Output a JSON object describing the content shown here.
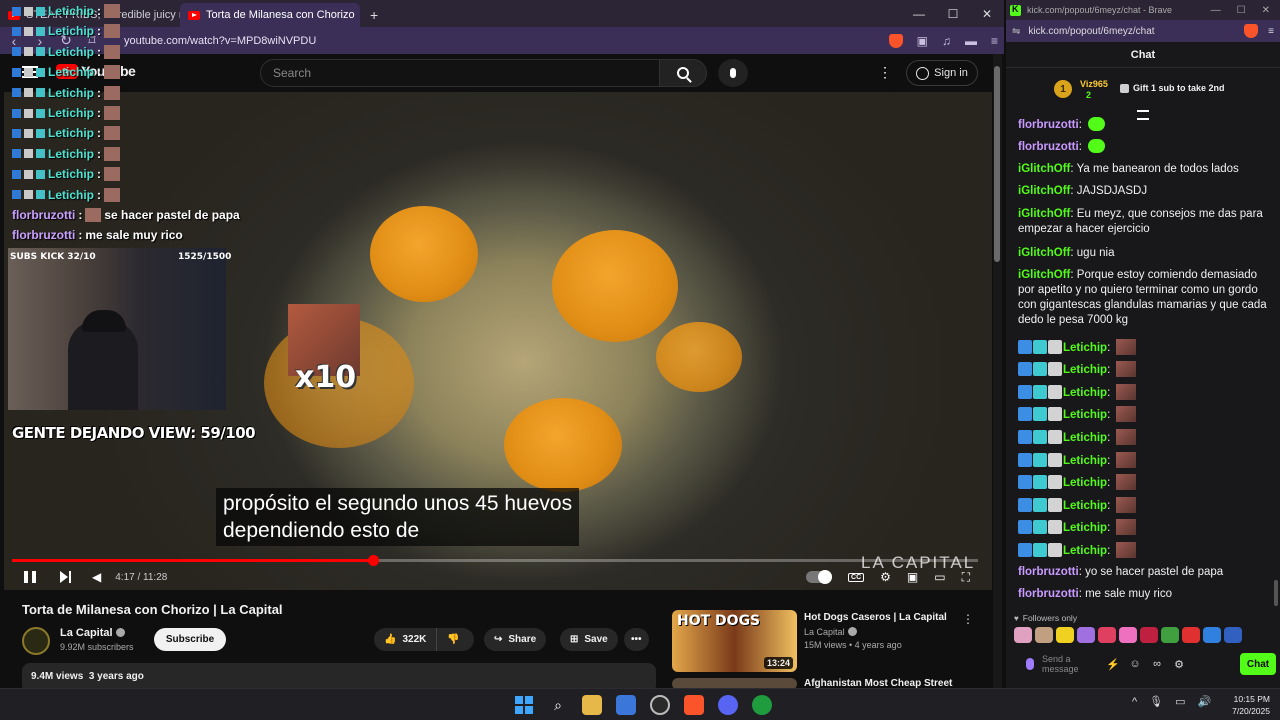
{
  "browser_left": {
    "tabs": [
      {
        "title": "STEAK FRIES, incredible juicy recipe",
        "active": false
      },
      {
        "title": "Torta de Milanesa con Chorizo",
        "active": true
      }
    ],
    "new_tab_glyph": "+",
    "window_controls": [
      "—",
      "☐",
      "✕"
    ],
    "url": "youtube.com/watch?v=MPD8wiNVPDU"
  },
  "youtube": {
    "logo_text": "YouTube",
    "search_placeholder": "Search",
    "sign_in_label": "Sign in",
    "video": {
      "caption_line1": "propósito el segundo unos 45 huevos",
      "caption_line2": "dependiendo esto de",
      "watermark": "LA CAPITAL",
      "time_display": "4:17 / 11:28",
      "progress_fraction": 0.374
    },
    "stream_overlay": {
      "subs_kick": "SUBS KICK 32/10",
      "subs_count": "1525/1500",
      "gente_view": "GENTE DEJANDO VIEW: 59/100",
      "multiplier": "x10"
    },
    "overlay_chat": [
      {
        "user": "Letichip",
        "text": ""
      },
      {
        "user": "Letichip",
        "text": ""
      },
      {
        "user": "Letichip",
        "text": ""
      },
      {
        "user": "Letichip",
        "text": ""
      },
      {
        "user": "Letichip",
        "text": ""
      },
      {
        "user": "Letichip",
        "text": ""
      },
      {
        "user": "Letichip",
        "text": ""
      },
      {
        "user": "Letichip",
        "text": ""
      },
      {
        "user": "Letichip",
        "text": ""
      },
      {
        "user": "Letichip",
        "text": ""
      },
      {
        "user": "florbruzotti",
        "text": "se hacer pastel de papa"
      },
      {
        "user": "florbruzotti",
        "text": "me sale muy rico"
      }
    ],
    "title": "Torta de Milanesa con Chorizo | La Capital",
    "channel": {
      "name": "La Capital",
      "subscribers": "9.92M subscribers"
    },
    "subscribe_label": "Subscribe",
    "likes": "322K",
    "share_label": "Share",
    "save_label": "Save",
    "more_glyph": "•••",
    "views": "9.4M views",
    "age": "3 years ago",
    "recommendations": [
      {
        "title": "Hot Dogs Caseros | La Capital",
        "channel": "La Capital",
        "meta": "15M views • 4 years ago",
        "duration": "13:24",
        "thumb_text": "HOT DOGS"
      },
      {
        "title": "Afghanistan Most Cheap Street",
        "channel": "",
        "meta": "",
        "duration": "",
        "thumb_text": ""
      }
    ]
  },
  "kick": {
    "window_title": "kick.com/popout/6meyz/chat - Brave",
    "url": "kick.com/popout/6meyz/chat",
    "chat_title": "Chat",
    "gifter": {
      "rank": "1",
      "user": "Viz965",
      "count": "2",
      "cta": "Gift 1 sub to take 2nd"
    },
    "messages": [
      {
        "user": "florbruzotti",
        "text": "",
        "style": "purple",
        "emote": "smile"
      },
      {
        "user": "florbruzotti",
        "text": "",
        "style": "purple",
        "emote": "smile"
      },
      {
        "user": "iGlitchOff",
        "text": "Ya me banearon de todos lados",
        "style": "green"
      },
      {
        "user": "iGlitchOff",
        "text": "JAJSDJASDJ",
        "style": "green"
      },
      {
        "user": "iGlitchOff",
        "text": "Eu meyz, que consejos me das para empezar a hacer ejercicio",
        "style": "green"
      },
      {
        "user": "iGlitchOff",
        "text": "ugu nia",
        "style": "green"
      },
      {
        "user": "iGlitchOff",
        "text": "Porque estoy comiendo demasiado por apetito y no quiero terminar como un gordo con gigantescas glandulas mamarias y que cada dedo le pesa 7000 kg",
        "style": "green"
      },
      {
        "user": "Letichip",
        "text": "",
        "style": "badged"
      },
      {
        "user": "Letichip",
        "text": "",
        "style": "badged"
      },
      {
        "user": "Letichip",
        "text": "",
        "style": "badged"
      },
      {
        "user": "Letichip",
        "text": "",
        "style": "badged"
      },
      {
        "user": "Letichip",
        "text": "",
        "style": "badged"
      },
      {
        "user": "Letichip",
        "text": "",
        "style": "badged"
      },
      {
        "user": "Letichip",
        "text": "",
        "style": "badged"
      },
      {
        "user": "Letichip",
        "text": "",
        "style": "badged"
      },
      {
        "user": "Letichip",
        "text": "",
        "style": "badged"
      },
      {
        "user": "Letichip",
        "text": "",
        "style": "badged"
      },
      {
        "user": "florbruzotti",
        "text": "yo se hacer pastel de papa",
        "style": "purple"
      },
      {
        "user": "florbruzotti",
        "text": "me sale muy rico",
        "style": "purple"
      }
    ],
    "followers_only": "Followers only",
    "input_placeholder": "Send a message",
    "chat_button": "Chat",
    "emote_colors": [
      "#e0a0c0",
      "#c0a080",
      "#f0d020",
      "#a070e0",
      "#e04060",
      "#f070c0",
      "#c02040",
      "#40a040",
      "#e03030",
      "#3080e0",
      "#3060c0"
    ]
  },
  "taskbar": {
    "time": "10:15 PM",
    "date": "7/20/2025",
    "tray_glyphs": [
      "^",
      "🎙",
      "▭",
      "🔊"
    ]
  },
  "colors": {
    "youtube_red": "#ff0000",
    "kick_green": "#53fc18",
    "browser_purple": "#3b2f58"
  }
}
